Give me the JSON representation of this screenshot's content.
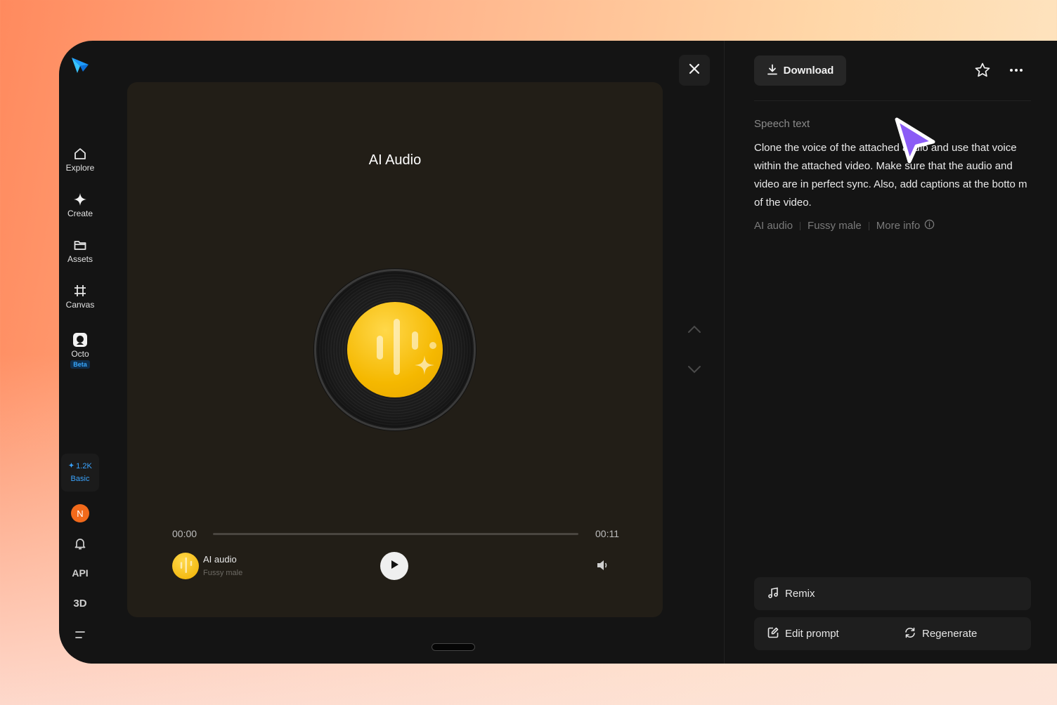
{
  "sidebar": {
    "items": [
      {
        "label": "Explore",
        "icon": "home-icon"
      },
      {
        "label": "Create",
        "icon": "sparkle-icon"
      },
      {
        "label": "Assets",
        "icon": "folder-icon"
      },
      {
        "label": "Canvas",
        "icon": "frame-icon"
      },
      {
        "label": "Octo",
        "icon": "octo-icon",
        "badge": "Beta"
      }
    ],
    "credits": {
      "amount": "1.2K",
      "plan": "Basic"
    },
    "avatar_initial": "N",
    "api_label": "API",
    "threed_label": "3D"
  },
  "player": {
    "title": "AI Audio",
    "current_time": "00:00",
    "duration": "00:11",
    "progress": 0,
    "track_title": "AI audio",
    "track_sub": "Fussy male"
  },
  "panel": {
    "download_label": "Download",
    "speech_label": "Speech text",
    "speech_text": "Clone the voice of the attached audio and use that voice within the attached video. Make sure that the audio and video are in perfect sync. Also, add captions at the botto m of the video.",
    "tags": [
      "AI audio",
      "Fussy male",
      "More info"
    ],
    "remix_label": "Remix",
    "edit_prompt_label": "Edit prompt",
    "regenerate_label": "Regenerate"
  },
  "colors": {
    "accent_blue": "#3aa4ff",
    "disc_yellow": "#f5b800",
    "avatar_orange": "#f26a1b",
    "cursor_purple": "#8b5cf6"
  }
}
